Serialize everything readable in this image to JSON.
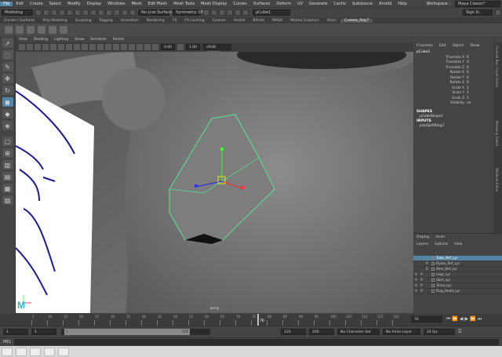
{
  "menubar": {
    "items": [
      "File",
      "Edit",
      "Create",
      "Select",
      "Modify",
      "Display",
      "Windows",
      "Mesh",
      "Edit Mesh",
      "Mesh Tools",
      "Mesh Display",
      "Curves",
      "Surfaces",
      "Deform",
      "UV",
      "Generate",
      "Cache",
      "Substance",
      "Arnold",
      "Help"
    ],
    "workspace_label": "Workspace :",
    "workspace_value": "Maya Classic*"
  },
  "statusline": {
    "mode": "Modeling",
    "live_surface": "No Live Surface",
    "symmetry": "Symmetry: Off",
    "search_value": "pCube1",
    "sign_in": "Sign In"
  },
  "shelf": {
    "tabs": [
      "Curves / Surfaces",
      "Poly Modeling",
      "Sculpting",
      "Rigging",
      "Animation",
      "Rendering",
      "FX",
      "FX Caching",
      "Custom",
      "Arnold",
      "Bifrost",
      "MASH",
      "Motion Graphics",
      "XGen",
      "Custom_PolyT"
    ],
    "active_tab": "Custom_PolyT"
  },
  "viewport": {
    "menus": [
      "View",
      "Shading",
      "Lighting",
      "Show",
      "Renderer",
      "Panels"
    ],
    "exposure": "0.00",
    "gamma": "1.00",
    "color_space": "sRGB gamma",
    "camera_label": "persp"
  },
  "channelbox": {
    "tabs": [
      "Channels",
      "Edit",
      "Object",
      "Show"
    ],
    "object": "pCube1",
    "attributes": [
      {
        "name": "Translate X",
        "value": "0"
      },
      {
        "name": "Translate Y",
        "value": "0"
      },
      {
        "name": "Translate Z",
        "value": "0"
      },
      {
        "name": "Rotate X",
        "value": "0"
      },
      {
        "name": "Rotate Y",
        "value": "0"
      },
      {
        "name": "Rotate Z",
        "value": "0"
      },
      {
        "name": "Scale X",
        "value": "1"
      },
      {
        "name": "Scale Y",
        "value": "1"
      },
      {
        "name": "Scale Z",
        "value": "1"
      },
      {
        "name": "Visibility",
        "value": "on"
      }
    ],
    "shapes_header": "SHAPES",
    "shape": "pCubeShape1",
    "inputs_header": "INPUTS",
    "input": "polySplitRing3"
  },
  "side_tabs": [
    "Channel Box / Layer Editor",
    "Modeling Toolkit",
    "Attribute Editor"
  ],
  "layers": {
    "tabs": [
      "Display",
      "Anim"
    ],
    "menus": [
      "Layers",
      "Options",
      "Help"
    ],
    "rows": [
      {
        "v": "",
        "p": "",
        "r": "",
        "name": "Tube_Ref_Lyr"
      },
      {
        "v": "",
        "p": "",
        "r": "R",
        "name": "Dylan_Ref_Lyr"
      },
      {
        "v": "",
        "p": "",
        "r": "R",
        "name": "Alex_Ref_Lyr"
      },
      {
        "v": "V",
        "p": "P",
        "r": "",
        "name": "Legs_Lyr"
      },
      {
        "v": "V",
        "p": "P",
        "r": "",
        "name": "Skirt_Lyr"
      },
      {
        "v": "V",
        "p": "P",
        "r": "",
        "name": "Torso_Lyr"
      },
      {
        "v": "V",
        "p": "P",
        "r": "",
        "name": "Dog_Head_Lyr"
      }
    ]
  },
  "timeline": {
    "ticks": [
      "5",
      "10",
      "15",
      "20",
      "25",
      "30",
      "35",
      "40",
      "45",
      "50",
      "55",
      "60",
      "65",
      "70",
      "75",
      "80",
      "85",
      "90",
      "95",
      "100",
      "105",
      "110",
      "115",
      "120"
    ],
    "current_frame": "76",
    "current_frame_field": "76"
  },
  "range": {
    "start": "1",
    "playback_start": "1",
    "range_start_val": "1",
    "range_end_val": "120",
    "playback_end": "120",
    "end": "200",
    "character_set": "No Character Set",
    "anim_layer": "No Anim Layer",
    "fps": "24 fps"
  },
  "cmdline": {
    "label": "MEL"
  }
}
